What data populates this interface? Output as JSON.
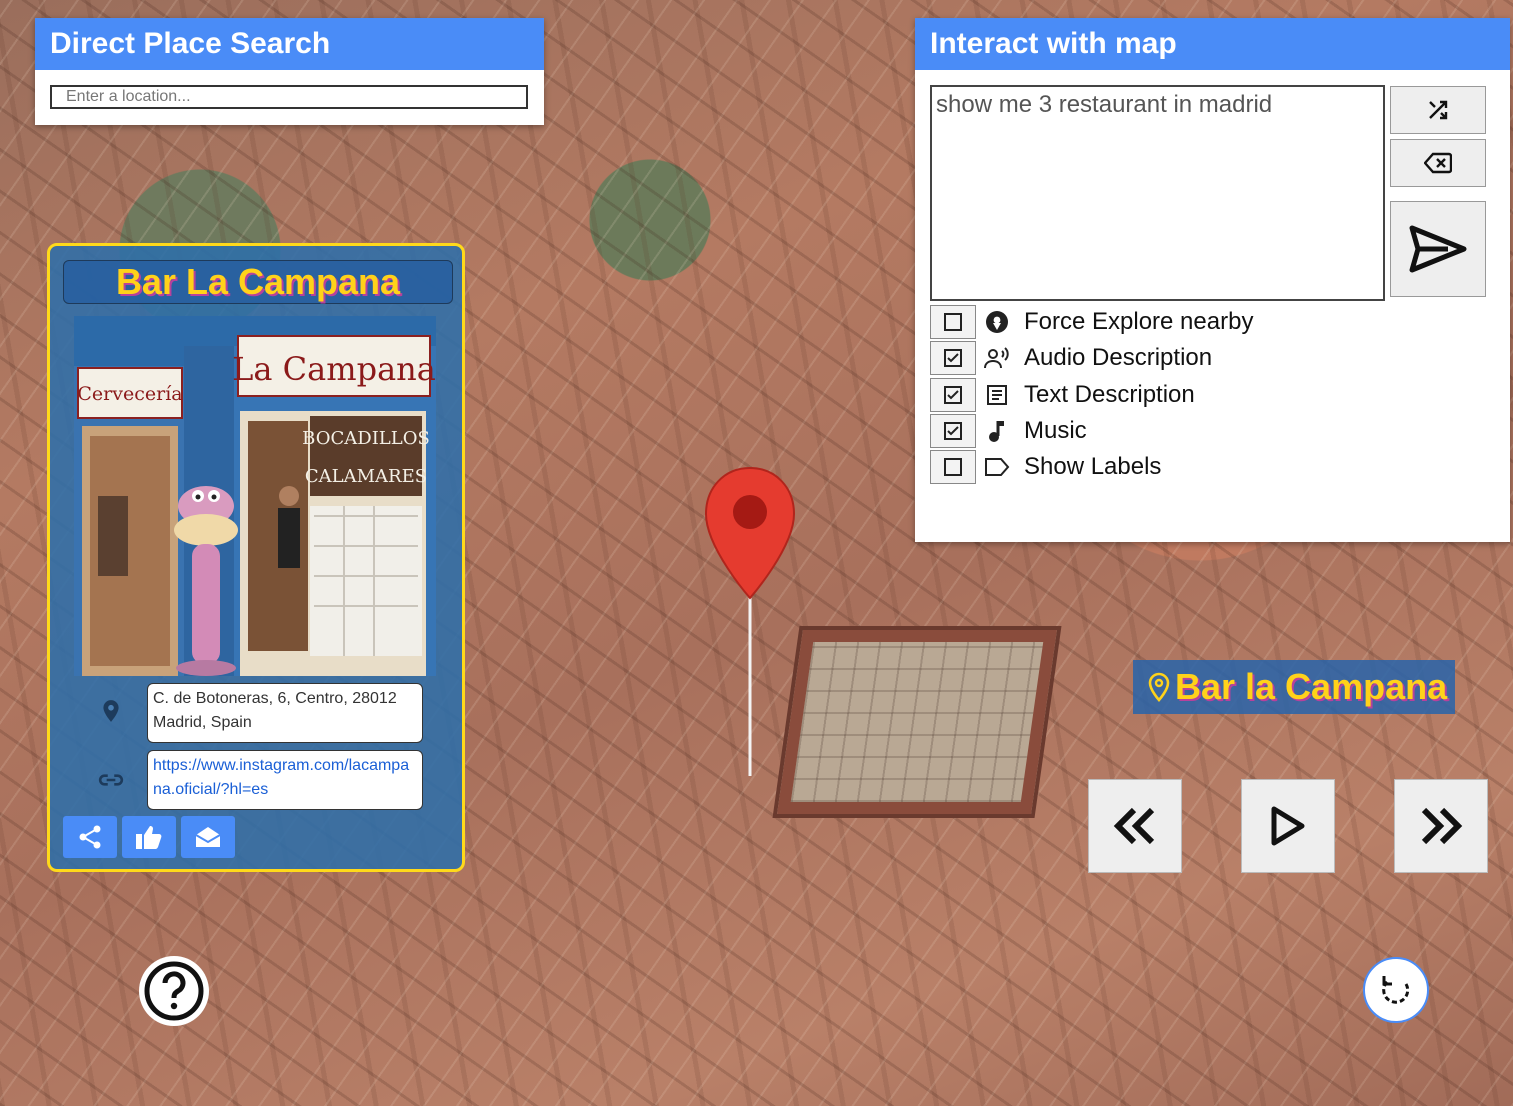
{
  "search_panel": {
    "title": "Direct Place Search",
    "placeholder": "Enter a location..."
  },
  "interact_panel": {
    "title": "Interact with map",
    "prompt_value": "show me 3 restaurant in madrid",
    "buttons": [
      "shuffle-icon",
      "backspace-icon",
      "send-icon"
    ],
    "options": [
      {
        "label": "Force Explore nearby",
        "checked": false,
        "icon": "location-pin-icon"
      },
      {
        "label": "Audio Description",
        "checked": true,
        "icon": "speaking-person-icon"
      },
      {
        "label": "Text Description",
        "checked": true,
        "icon": "document-icon"
      },
      {
        "label": "Music",
        "checked": true,
        "icon": "music-note-icon"
      },
      {
        "label": "Show Labels",
        "checked": false,
        "icon": "label-tag-icon"
      }
    ]
  },
  "place_card": {
    "title": "Bar La Campana",
    "photo_signs": {
      "left_sign": "Cervecería",
      "main_sign": "La Campana",
      "board_1": "BOCADILLOS",
      "board_2": "CALAMARES"
    },
    "address": "C. de Botoneras, 6, Centro, 28012 Madrid, Spain",
    "link": "https://www.instagram.com/lacampana.oficial/?hl=es",
    "actions": [
      "share-icon",
      "thumbs-up-icon",
      "email-icon"
    ]
  },
  "map": {
    "place_label": "Bar la Campana",
    "controls": [
      "rewind-icon",
      "play-icon",
      "fast-forward-icon"
    ],
    "accent_color": "#4a8cf7",
    "title_color": "#ffd21a"
  }
}
